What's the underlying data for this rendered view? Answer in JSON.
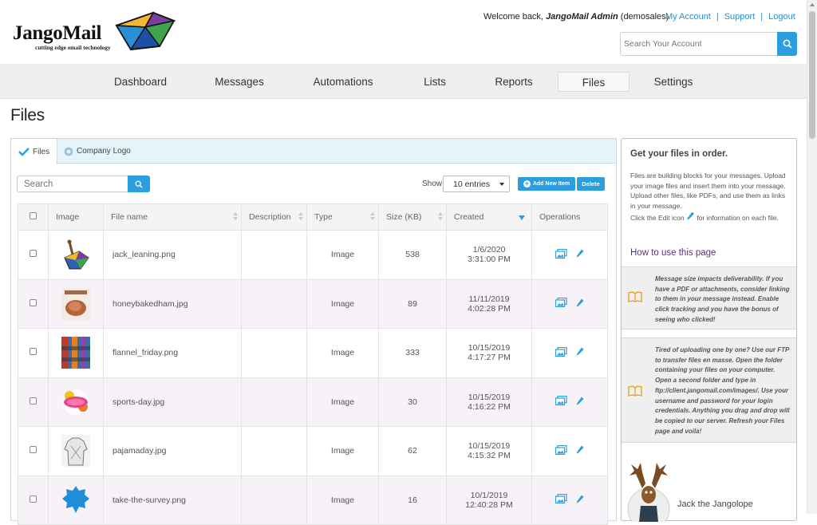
{
  "brand": {
    "name": "JangoMail",
    "tagline": "cutting edge email technology"
  },
  "header": {
    "welcome_prefix": "Welcome back,",
    "welcome_user": "JangoMail Admin",
    "welcome_account": "(demosales)",
    "links": [
      "My Account",
      "Support",
      "Logout"
    ],
    "search_placeholder": "Search Your Account"
  },
  "nav": [
    "Dashboard",
    "Messages",
    "Automations",
    "Lists",
    "Reports",
    "Files",
    "Settings"
  ],
  "nav_active": "Files",
  "page_title": "Files",
  "tabs": [
    "Files",
    "Company Logo"
  ],
  "toolbar": {
    "search_placeholder": "Search",
    "show_label": "Show",
    "entries_value": "10 entries",
    "add_label": "Add New Item",
    "delete_label": "Delete"
  },
  "table": {
    "columns": [
      "Image",
      "File name",
      "Description",
      "Type",
      "Size (KB)",
      "Created",
      "Operations"
    ],
    "rows": [
      {
        "file": "jack_leaning.png",
        "type": "Image",
        "size": "538",
        "date": "1/6/2020",
        "time": "3:31:00 PM"
      },
      {
        "file": "honeybakedham.jpg",
        "type": "Image",
        "size": "89",
        "date": "11/11/2019",
        "time": "4:02:28 PM"
      },
      {
        "file": "flannel_friday.png",
        "type": "Image",
        "size": "333",
        "date": "10/15/2019",
        "time": "4:17:27 PM"
      },
      {
        "file": "sports-day.jpg",
        "type": "Image",
        "size": "30",
        "date": "10/15/2019",
        "time": "4:16:22 PM"
      },
      {
        "file": "pajamaday.jpg",
        "type": "Image",
        "size": "62",
        "date": "10/15/2019",
        "time": "4:15:32 PM"
      },
      {
        "file": "take-the-survey.png",
        "type": "Image",
        "size": "16",
        "date": "10/1/2019",
        "time": "12:40:28 PM"
      }
    ]
  },
  "sidebar": {
    "heading": "Get your files in order.",
    "intro": "Files are building blocks for your messages. Upload your image files and insert them into your message. Upload other files, like PDFs, and use them as links in your message.",
    "edit_before": "Click the Edit icon",
    "edit_after": "for information on each file.",
    "howto": "How to use this page",
    "tip1": "Message size impacts deliverability. If you have a PDF or attachments, consider linking to them in your message instead. Enable click tracking and you have the bonus of seeing who clicked!",
    "tip2_a": "Tired of uploading one by one? Use our FTP to transfer files en masse. Open the folder containing your files on your computer. Open a second folder and type in",
    "tip2_link": "ftp://client.jangomail.com/images/.",
    "tip2_b": "Use your username and password for your login credentials. Anything you drag and drop will be copied to our server. Refresh your Files page and voila!",
    "mascot_name": "Jack the Jangolope"
  },
  "colors": {
    "accent": "#2c9ee0",
    "link_purple": "#5a2f86",
    "row_alt": "#f7f2f8",
    "tab_bar": "#e5f3fb"
  }
}
